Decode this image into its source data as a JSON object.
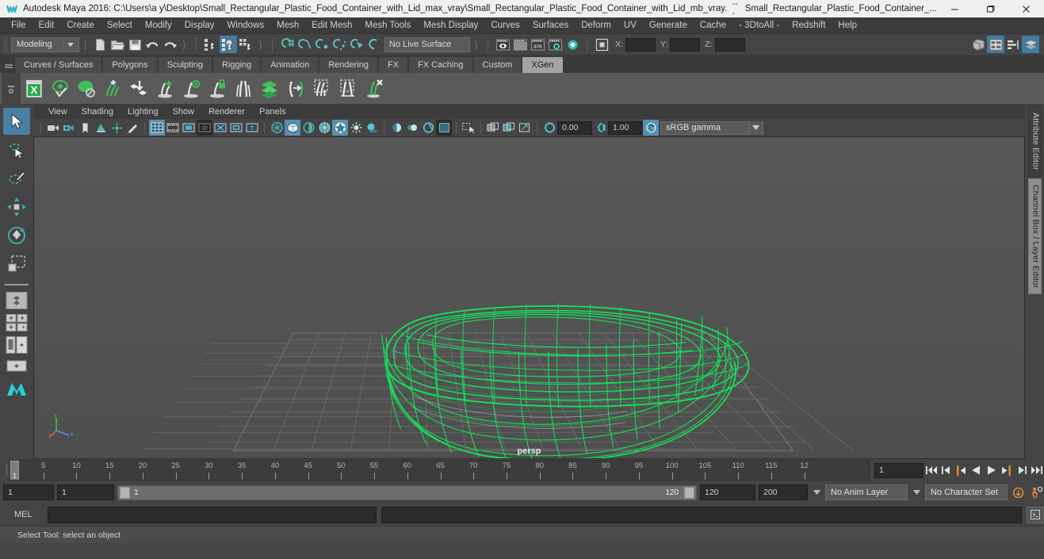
{
  "titlebar": {
    "app_title": "Autodesk Maya 2016: C:\\Users\\a y\\Desktop\\Small_Rectangular_Plastic_Food_Container_with_Lid_max_vray\\Small_Rectangular_Plastic_Food_Container_with_Lid_mb_vray.mb*",
    "separator": "---",
    "secondary_title": "Small_Rectangular_Plastic_Food_Container_...",
    "minimize": "—",
    "maximize": "❐",
    "close": "✕"
  },
  "menubar": {
    "items": [
      "File",
      "Edit",
      "Create",
      "Select",
      "Modify",
      "Display",
      "Windows",
      "Mesh",
      "Edit Mesh",
      "Mesh Tools",
      "Mesh Display",
      "Curves",
      "Surfaces",
      "Deform",
      "UV",
      "Generate",
      "Cache",
      "- 3DtoAll -",
      "Redshift",
      "Help"
    ]
  },
  "statusline": {
    "mode": "Modeling",
    "live_surface": "No Live Surface",
    "coord_x_label": "X:",
    "coord_y_label": "Y:",
    "coord_z_label": "Z:",
    "coord_x_value": "",
    "coord_y_value": "",
    "coord_z_value": "",
    "icons": [
      "new-scene-icon",
      "open-scene-icon",
      "save-scene-icon",
      "undo-icon",
      "redo-icon",
      "select-by-hierarchy-icon",
      "select-by-object-icon",
      "select-by-component-icon",
      "snap-to-grid-icon",
      "snap-to-curve-icon",
      "snap-to-point-icon",
      "snap-to-projected-center-icon",
      "snap-to-view-plane-icon",
      "make-live-icon",
      "render-view-icon",
      "render-current-frame-icon",
      "ipr-render-icon",
      "render-settings-icon",
      "hypershade-icon",
      "editor-layout-icon",
      "show-hide-modeling-toolkit-icon",
      "show-hide-attribute-editor-icon",
      "show-hide-tool-settings-icon",
      "show-hide-channel-box-icon"
    ]
  },
  "shelf": {
    "tabs": [
      "Curves / Surfaces",
      "Polygons",
      "Sculpting",
      "Rigging",
      "Animation",
      "Rendering",
      "FX",
      "FX Caching",
      "Custom",
      "XGen"
    ],
    "active_tab": "XGen",
    "icons": [
      "xgen-editor-icon",
      "xgen-preview-icon",
      "xgen-disable-preview-icon",
      "xgen-add-description-icon",
      "xgen-import-collection-icon",
      "xgen-add-guide-icon",
      "xgen-select-guide-icon",
      "xgen-lock-guide-icon",
      "xgen-mirror-guide-icon",
      "xgen-layers-icon",
      "xgen-convert-guide-icon",
      "xgen-grooming-brush-icon",
      "xgen-region-select-icon",
      "xgen-delete-guide-icon"
    ]
  },
  "toolbox": {
    "tools": [
      "select-tool",
      "lasso-select-tool",
      "paint-select-tool",
      "move-tool",
      "rotate-tool",
      "scale-tool"
    ],
    "active_tool": "select-tool",
    "layouts": [
      "single-perspective-layout",
      "four-view-layout",
      "persp-outliner-layout",
      "persp-graph-layout",
      "maya-bookmark-icon"
    ]
  },
  "viewport": {
    "menus": [
      "View",
      "Shading",
      "Lighting",
      "Show",
      "Renderer",
      "Panels"
    ],
    "camera_label": "persp",
    "exposure_value": "0.00",
    "gamma_value": "1.00",
    "color_profile": "sRGB gamma",
    "axis_labels": {
      "x": "x",
      "y": "y",
      "z": "z"
    },
    "toolbar_icons": [
      "select-camera-icon",
      "camera-attributes-icon",
      "bookmark-icon",
      "image-plane-icon",
      "two-d-pan-zoom-icon",
      "grease-pencil-icon",
      "grid-icon",
      "film-gate-icon",
      "resolution-gate-icon",
      "gate-mask-icon",
      "field-chart-icon",
      "safe-action-icon",
      "safe-title-icon",
      "wireframe-icon",
      "smooth-shade-all-icon",
      "shade-selected-icon",
      "wireframe-on-shaded-icon",
      "texture-icon",
      "use-all-lights-icon",
      "shadows-icon",
      "screen-space-ao-icon",
      "motion-blur-icon",
      "multisample-icon",
      "isolate-select-icon",
      "xray-icon",
      "xray-joints-icon",
      "xray-active-components-icon",
      "exposure-icon",
      "gamma-icon",
      "view-transform-icon"
    ]
  },
  "rightdock": {
    "tabs": [
      "Attribute Editor",
      "Channel Box / Layer Editor"
    ],
    "active_tab": "Channel Box / Layer Editor"
  },
  "timeline": {
    "start_visible": 1,
    "tick_labels": [
      5,
      10,
      15,
      20,
      25,
      30,
      35,
      40,
      45,
      50,
      55,
      60,
      65,
      70,
      75,
      80,
      85,
      90,
      95,
      100,
      105,
      110,
      115,
      "12"
    ],
    "current_frame_marker": "1",
    "current_frame_field": "1",
    "playback_buttons": [
      "go-to-start-icon",
      "step-back-keyframe-icon",
      "step-back-frame-icon",
      "play-backwards-icon",
      "play-forwards-icon",
      "step-forward-frame-icon",
      "step-forward-keyframe-icon",
      "go-to-end-icon"
    ]
  },
  "range": {
    "anim_start": "1",
    "range_start": "1",
    "slider_start_label": "1",
    "slider_end_label": "120",
    "range_end": "120",
    "anim_end": "200",
    "anim_layer": "No Anim Layer",
    "character_set": "No Character Set",
    "auto_key_icon": "auto-keyframe-icon",
    "anim_prefs_icon": "animation-preferences-icon"
  },
  "mel": {
    "label": "MEL",
    "input_value": "",
    "output_value": "",
    "script_editor_icon": "script-editor-icon"
  },
  "statusbar": {
    "help_text": "Select Tool: select an object"
  },
  "colors": {
    "accent_blue": "#4a7fa3",
    "mesh_green": "#15e05a",
    "panel_bg": "#444444",
    "viewport_bg": "#545454",
    "title_bg": "#f0f0f0",
    "shelf_active": "#a3a3a3"
  }
}
